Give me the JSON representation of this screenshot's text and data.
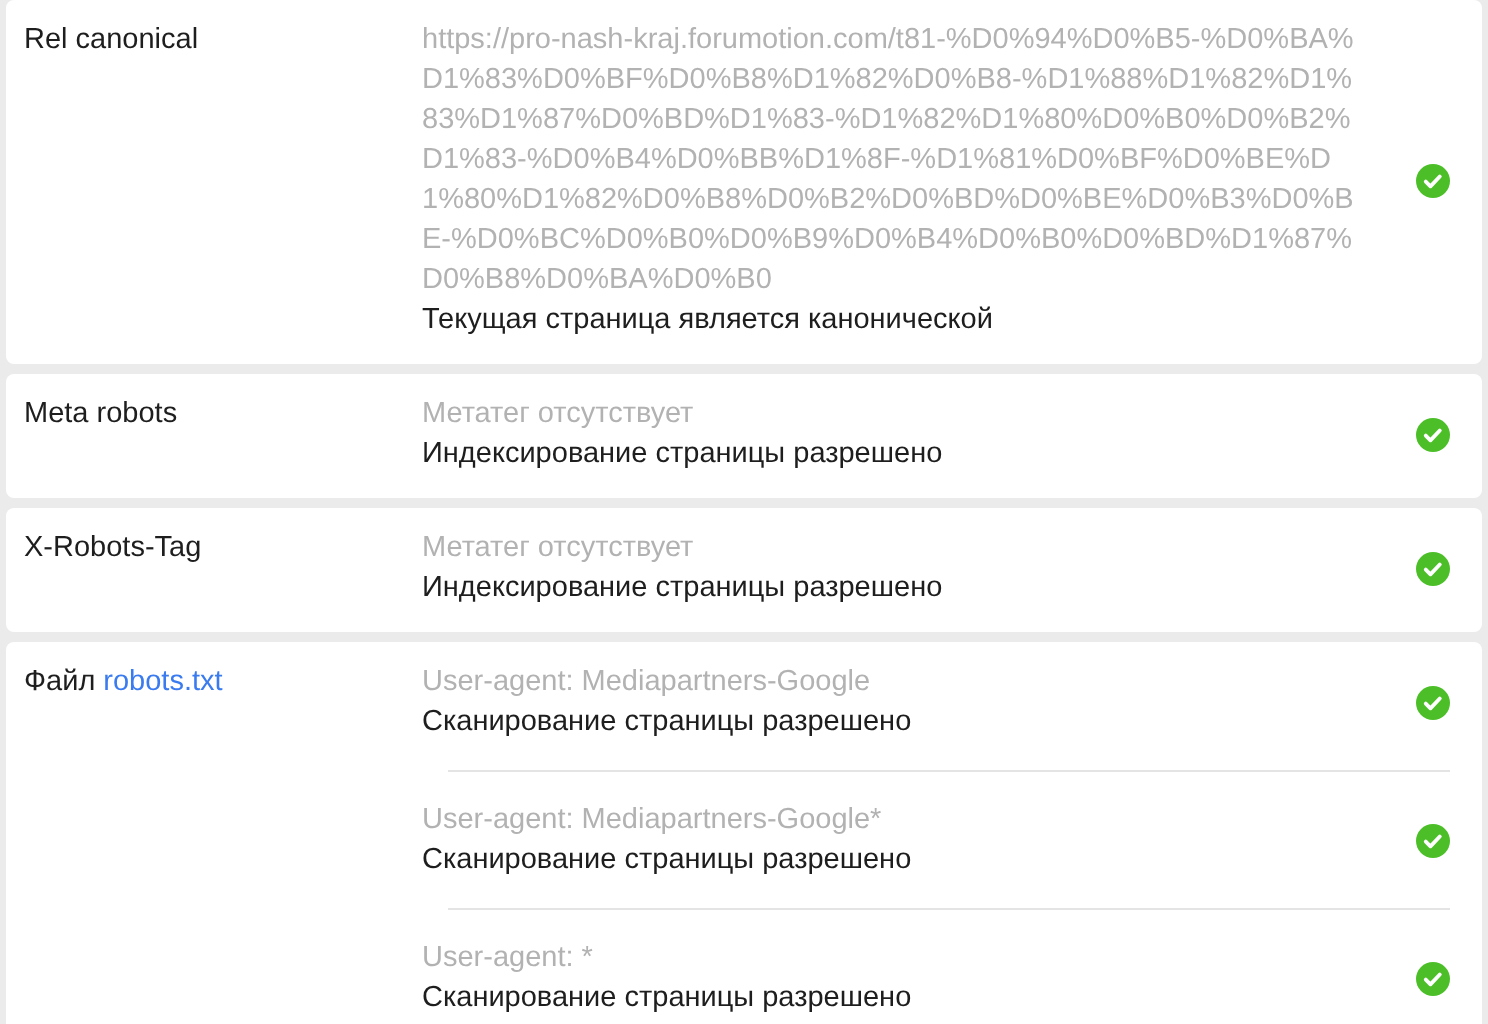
{
  "sections": [
    {
      "label": "Rel canonical",
      "items": [
        {
          "detail": "https://pro-nash-kraj.forumotion.com/t81-%D0%94%D0%B5-%D0%BA%D1%83%D0%BF%D0%B8%D1%82%D0%B8-%D1%88%D1%82%D1%83%D1%87%D0%BD%D1%83-%D1%82%D1%80%D0%B0%D0%B2%D1%83-%D0%B4%D0%BB%D1%8F-%D1%81%D0%BF%D0%BE%D1%80%D1%82%D0%B8%D0%B2%D0%BD%D0%BE%D0%B3%D0%BE-%D0%BC%D0%B0%D0%B9%D0%B4%D0%B0%D0%BD%D1%87%D0%B8%D0%BA%D0%B0",
          "result": "Текущая страница является канонической",
          "passed": true
        }
      ]
    },
    {
      "label": "Meta robots",
      "items": [
        {
          "detail": "Метатег отсутствует",
          "result": "Индексирование страницы разрешено",
          "passed": true
        }
      ]
    },
    {
      "label": "X-Robots-Tag",
      "items": [
        {
          "detail": "Метатег отсутствует",
          "result": "Индексирование страницы разрешено",
          "passed": true
        }
      ]
    },
    {
      "label": "Файл",
      "link": "robots.txt",
      "items": [
        {
          "detail": "User-agent: Mediapartners-Google",
          "result": "Сканирование страницы разрешено",
          "passed": true
        },
        {
          "detail": "User-agent: Mediapartners-Google*",
          "result": "Сканирование страницы разрешено",
          "passed": true
        },
        {
          "detail": "User-agent: *",
          "result": "Сканирование страницы разрешено",
          "passed": true
        }
      ]
    }
  ]
}
